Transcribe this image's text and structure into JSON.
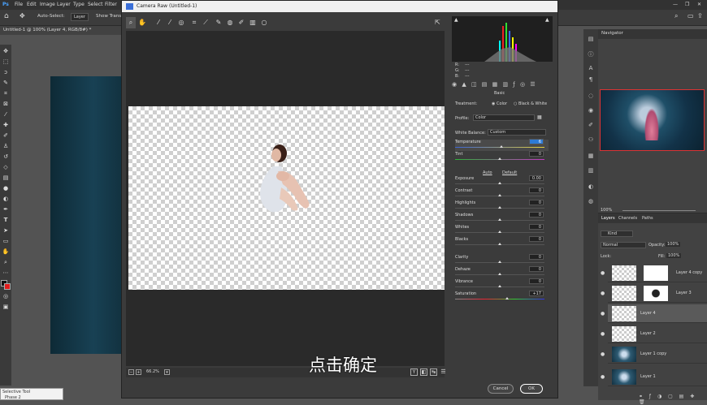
{
  "menubar": {
    "items": [
      "File",
      "Edit",
      "Image",
      "Layer",
      "Type",
      "Select",
      "Filter"
    ]
  },
  "options": {
    "auto_select": "Auto-Select:",
    "layer_dropdown": "Layer",
    "show_transform": "Show Trans"
  },
  "doc_tab": "Untitled-1 @ 100% (Layer 4, RGB/8#) *",
  "dialog": {
    "title": "Camera Raw (Untitled-1)",
    "zoom": "66.2%",
    "caption": "点击确定",
    "cancel": "Cancel",
    "ok": "OK",
    "rgb": {
      "r": "R:",
      "g": "G:",
      "b": "B:",
      "r_val": "---",
      "g_val": "---",
      "b_val": "---"
    },
    "panel_title": "Basic",
    "treatment_label": "Treatment:",
    "treatment_color": "Color",
    "treatment_bw": "Black & White",
    "profile_label": "Profile:",
    "profile_value": "Color",
    "wb_label": "White Balance:",
    "wb_value": "Custom",
    "auto": "Auto",
    "default": "Default",
    "sliders": [
      {
        "label": "Temperature",
        "value": "6",
        "pos": 0.52
      },
      {
        "label": "Tint",
        "value": "0",
        "pos": 0.5
      },
      {
        "label": "Exposure",
        "value": "0.00",
        "pos": 0.5
      },
      {
        "label": "Contrast",
        "value": "0",
        "pos": 0.5
      },
      {
        "label": "Highlights",
        "value": "0",
        "pos": 0.5
      },
      {
        "label": "Shadows",
        "value": "0",
        "pos": 0.5
      },
      {
        "label": "Whites",
        "value": "0",
        "pos": 0.5
      },
      {
        "label": "Blacks",
        "value": "0",
        "pos": 0.5
      },
      {
        "label": "Clarity",
        "value": "0",
        "pos": 0.5
      },
      {
        "label": "Dehaze",
        "value": "0",
        "pos": 0.5
      },
      {
        "label": "Vibrance",
        "value": "0",
        "pos": 0.5
      },
      {
        "label": "Saturation",
        "value": "+17",
        "pos": 0.58
      }
    ]
  },
  "navigator": {
    "title": "Navigator",
    "zoom": "100%"
  },
  "layers": {
    "tabs": [
      "Layers",
      "Channels",
      "Paths"
    ],
    "kind": "Kind",
    "blend": "Normal",
    "opacity_label": "Opacity:",
    "opacity": "100%",
    "lock_label": "Lock:",
    "fill_label": "Fill:",
    "fill": "100%",
    "rows": [
      {
        "name": "Layer 4 copy",
        "has_mask": true
      },
      {
        "name": "Layer 3",
        "has_mask": true
      },
      {
        "name": "Layer 4",
        "has_mask": false
      },
      {
        "name": "Layer 2",
        "has_mask": false
      },
      {
        "name": "Layer 1 copy",
        "has_mask": false
      },
      {
        "name": "Layer 1",
        "has_mask": false
      }
    ]
  },
  "bottom_tab": "Selective Tool",
  "bottom_sub": "Phase 2",
  "colors": {
    "accent": "#2d7ad6",
    "ok_border": "#ffffff"
  }
}
